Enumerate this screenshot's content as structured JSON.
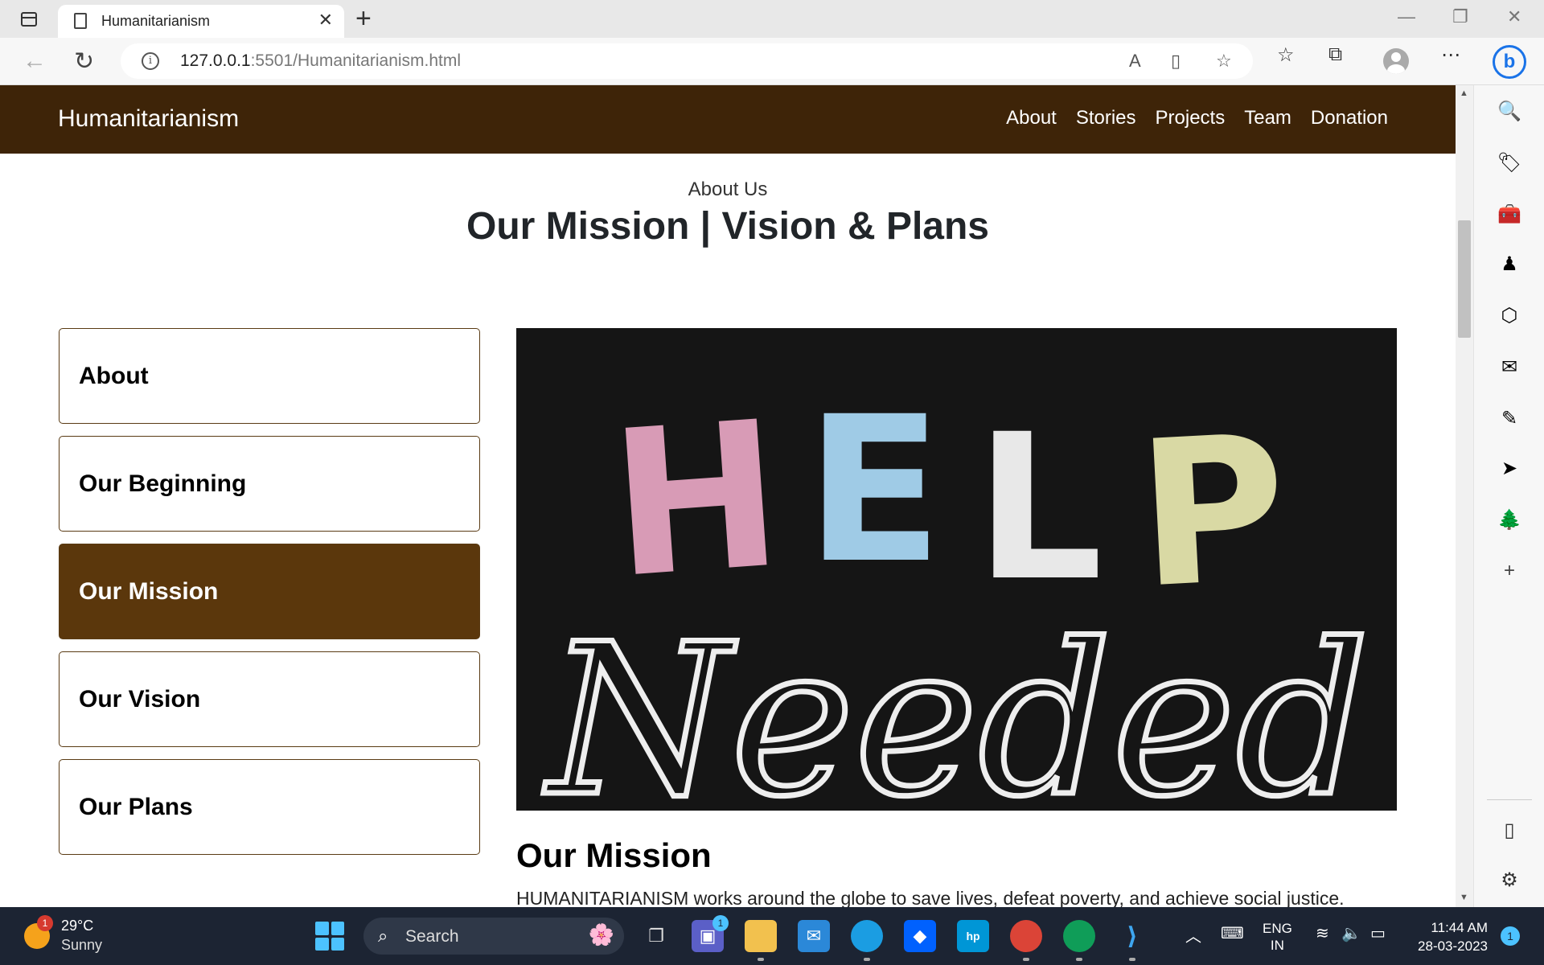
{
  "browser": {
    "tab_title": "Humanitarianism",
    "url_host": "127.0.0.1",
    "url_rest": ":5501/Humanitarianism.html"
  },
  "site": {
    "brand": "Humanitarianism",
    "nav": [
      "About",
      "Stories",
      "Projects",
      "Team",
      "Donation"
    ]
  },
  "hero_section": {
    "eyebrow": "About Us",
    "heading": "Our Mission | Vision & Plans"
  },
  "side_menu": {
    "items": [
      "About",
      "Our Beginning",
      "Our Mission",
      "Our Vision",
      "Our Plans"
    ],
    "active": "Our Mission"
  },
  "image": {
    "word_1": "HELP",
    "word_2": "Needed"
  },
  "content": {
    "title": "Our Mission",
    "paragraph": "HUMANITARIANISM works around the globe to save lives, defeat poverty, and achieve social justice."
  },
  "taskbar": {
    "weather_temp": "29°C",
    "weather_desc": "Sunny",
    "weather_badge": "1",
    "search_label": "Search",
    "teams_badge": "1",
    "lang_line1": "ENG",
    "lang_line2": "IN",
    "time": "11:44 AM",
    "date": "28-03-2023",
    "notifications": "1"
  },
  "colors": {
    "site_nav_bg": "#3e2408",
    "active_menu_bg": "#5b370c",
    "menu_border": "#5a3b14",
    "taskbar_bg": "#1c2433"
  }
}
